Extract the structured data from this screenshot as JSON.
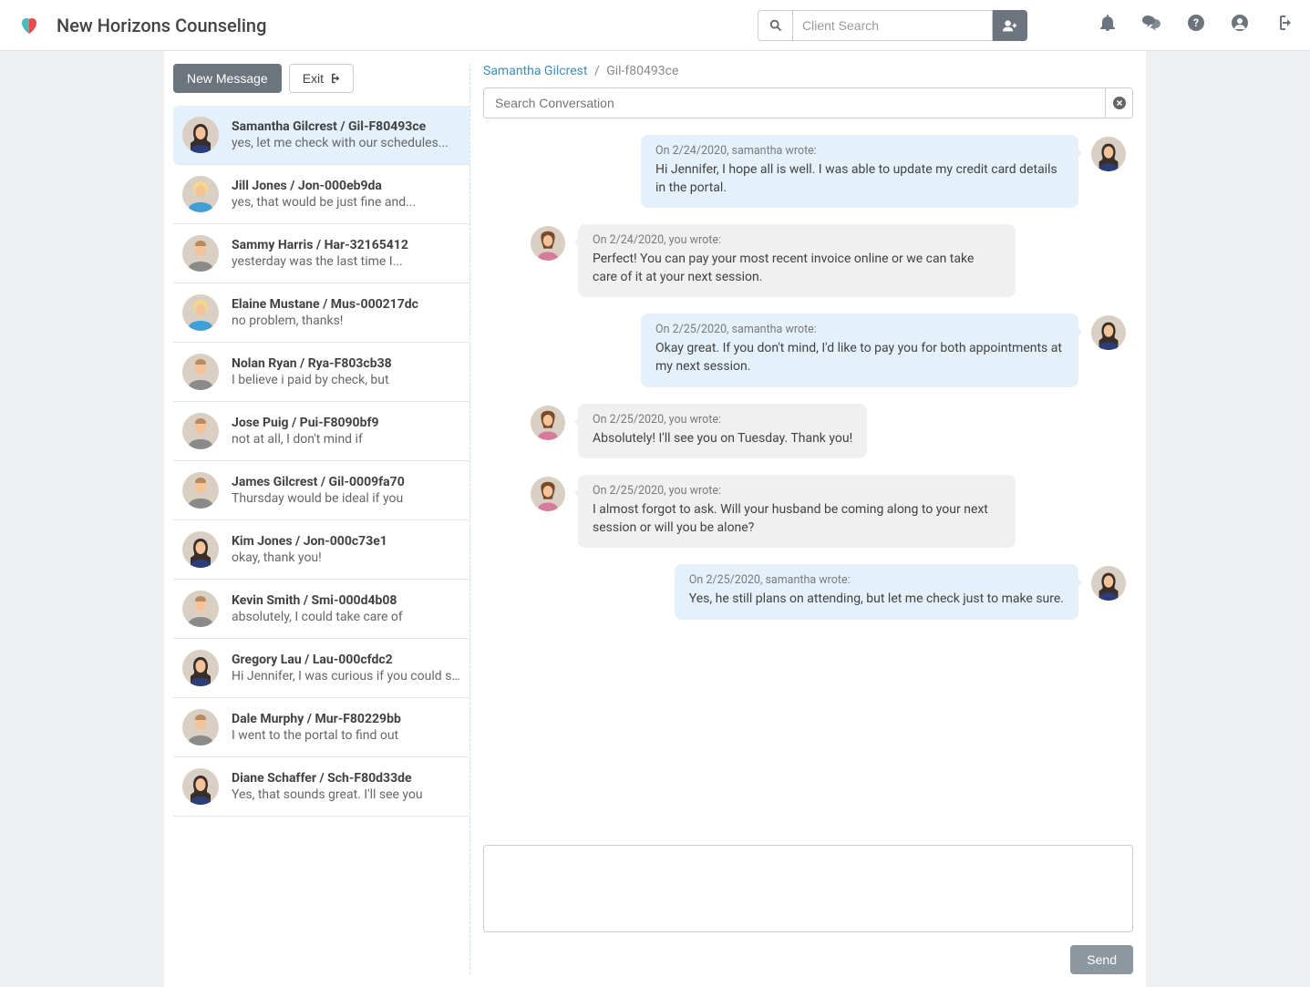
{
  "brand": "New Horizons Counseling",
  "search": {
    "placeholder": "Client Search"
  },
  "sidebar": {
    "new_message": "New Message",
    "exit": "Exit",
    "conversations": [
      {
        "name": "Samantha Gilcrest / Gil-F80493ce",
        "preview": "yes, let me check with our schedules...",
        "avatar_type": "female_dark"
      },
      {
        "name": "Jill Jones / Jon-000eb9da",
        "preview": "yes, that would be just fine and...",
        "avatar_type": "blonde_blue"
      },
      {
        "name": "Sammy Harris / Har-32165412",
        "preview": "yesterday was the last time I...",
        "avatar_type": "male_grey"
      },
      {
        "name": "Elaine Mustane / Mus-000217dc",
        "preview": "no problem, thanks!",
        "avatar_type": "blonde_blue"
      },
      {
        "name": "Nolan Ryan / Rya-F803cb38",
        "preview": "I believe i paid by check, but",
        "avatar_type": "male_grey"
      },
      {
        "name": "Jose Puig / Pui-F8090bf9",
        "preview": "not at all, I don't mind if",
        "avatar_type": "male_grey"
      },
      {
        "name": "James Gilcrest / Gil-0009fa70",
        "preview": "Thursday would be ideal if you",
        "avatar_type": "male_grey"
      },
      {
        "name": "Kim Jones / Jon-000c73e1",
        "preview": "okay, thank you!",
        "avatar_type": "female_dark"
      },
      {
        "name": "Kevin Smith / Smi-000d4b08",
        "preview": "absolutely, I could take care of",
        "avatar_type": "male_grey"
      },
      {
        "name": "Gregory Lau / Lau-000cfdc2",
        "preview": "Hi Jennifer, I was curious if you could send",
        "avatar_type": "female_dark"
      },
      {
        "name": "Dale Murphy / Mur-F80229bb",
        "preview": "I went to the portal to find out",
        "avatar_type": "male_grey"
      },
      {
        "name": "Diane Schaffer / Sch-F80d33de",
        "preview": "Yes, that sounds great. I'll see you",
        "avatar_type": "female_dark"
      }
    ]
  },
  "chat": {
    "breadcrumb_name": "Samantha Gilcrest",
    "breadcrumb_id": "Gil-f80493ce",
    "search_placeholder": "Search Conversation",
    "messages": [
      {
        "from": "other",
        "meta": "On 2/24/2020, samantha wrote:",
        "body": "Hi Jennifer, I hope all is well. I was able to update my credit card details in the portal."
      },
      {
        "from": "self",
        "meta": "On 2/24/2020, you wrote:",
        "body": "Perfect! You can pay your most recent invoice online or we can take care of it at your next session."
      },
      {
        "from": "other",
        "meta": "On 2/25/2020, samantha wrote:",
        "body": "Okay great. If you don't mind, I'd like to pay you for both appointments at my next session."
      },
      {
        "from": "self",
        "meta": "On 2/25/2020, you wrote:",
        "body": "Absolutely! I'll see you on Tuesday. Thank you!"
      },
      {
        "from": "self",
        "meta": "On 2/25/2020, you wrote:",
        "body": "I almost forgot to ask. Will your husband be coming along to your next session or will you be alone?"
      },
      {
        "from": "other",
        "meta": "On 2/25/2020, samantha wrote:",
        "body": "Yes, he still plans on attending, but let me check just to make sure."
      }
    ],
    "send": "Send"
  }
}
